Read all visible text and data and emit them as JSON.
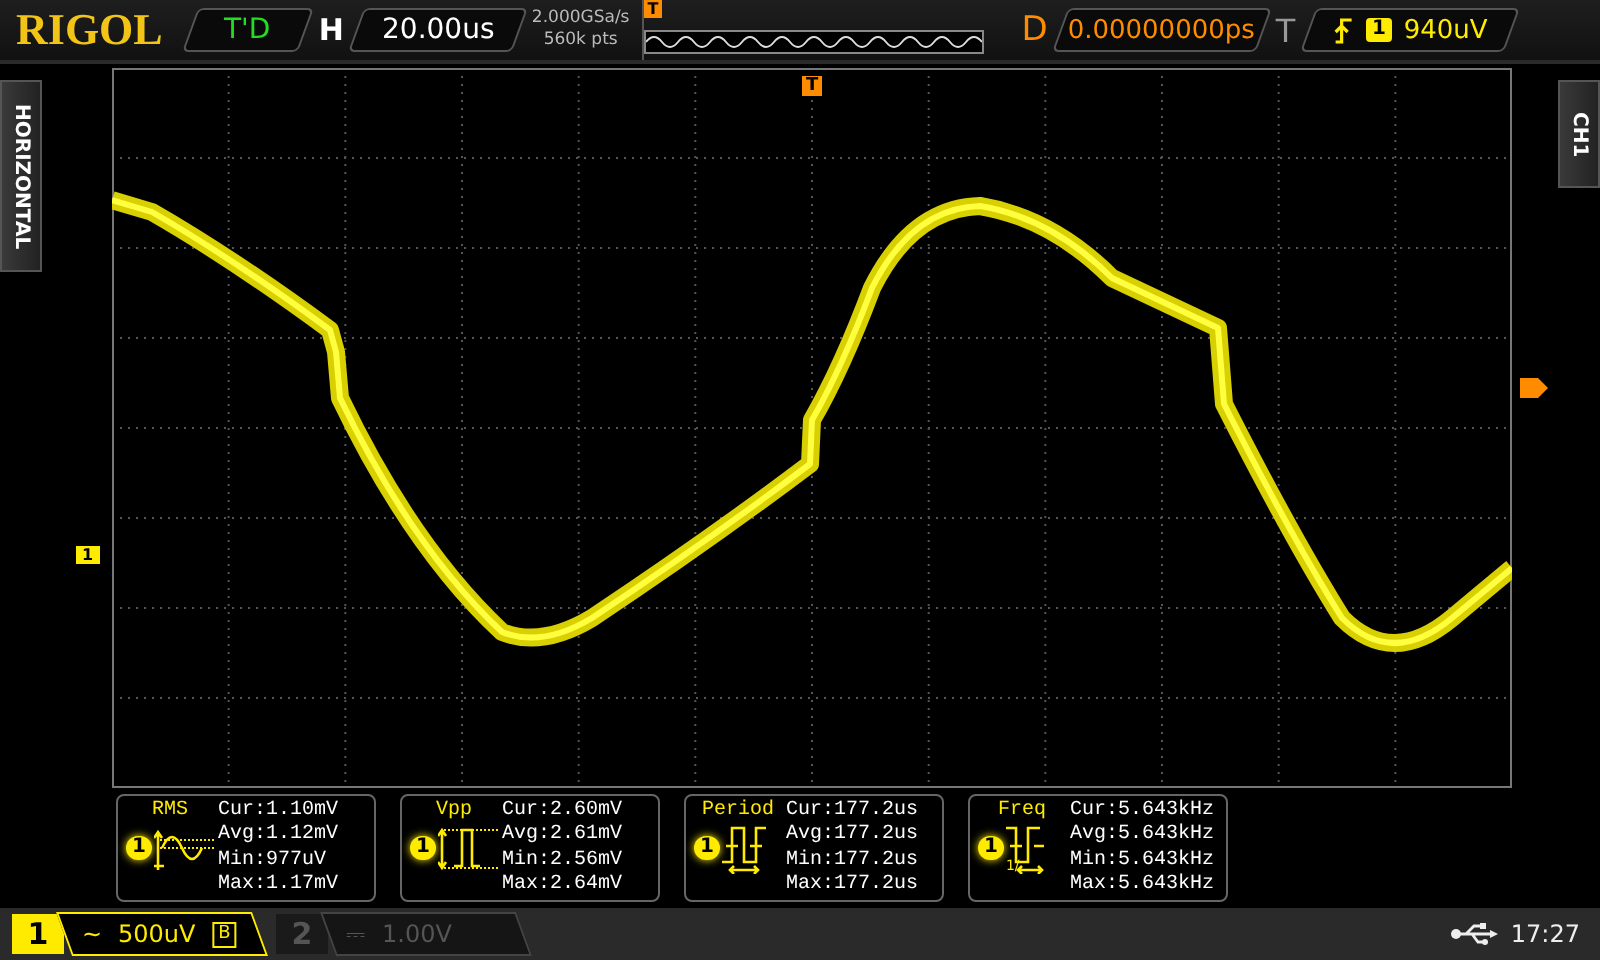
{
  "top_bar": {
    "logo": "RIGOL",
    "run_status": "T'D",
    "timebase_label": "H",
    "timebase": "20.00us",
    "sample_rate": "2.000GSa/s",
    "memory_depth": "560k pts",
    "overview_marker": "T",
    "delay_label": "D",
    "delay": "0.00000000ps",
    "trigger_label": "T",
    "trigger_source": "1",
    "trigger_level": "940uV"
  },
  "side_tabs": {
    "left": "HORIZONTAL",
    "right": "CH1"
  },
  "screen": {
    "trigger_position_marker": "T",
    "channel_marker": "1"
  },
  "measurements": [
    {
      "kind": "rms",
      "label": "RMS",
      "channel": "1",
      "cur": "Cur:1.10mV",
      "avg": "Avg:1.12mV",
      "min": "Min:977uV",
      "max": "Max:1.17mV"
    },
    {
      "kind": "vpp",
      "label": "Vpp",
      "channel": "1",
      "cur": "Cur:2.60mV",
      "avg": "Avg:2.61mV",
      "min": "Min:2.56mV",
      "max": "Max:2.64mV"
    },
    {
      "kind": "period",
      "label": "Period",
      "channel": "1",
      "cur": "Cur:177.2us",
      "avg": "Avg:177.2us",
      "min": "Min:177.2us",
      "max": "Max:177.2us"
    },
    {
      "kind": "freq",
      "label": "Freq",
      "channel": "1",
      "icon_note": "1/",
      "cur": "Cur:5.643kHz",
      "avg": "Avg:5.643kHz",
      "min": "Min:5.643kHz",
      "max": "Max:5.643kHz"
    }
  ],
  "channels": [
    {
      "number": "1",
      "coupling": "~",
      "scale": "500uV",
      "bw_limit": "B",
      "enabled": true
    },
    {
      "number": "2",
      "coupling": "⎓",
      "scale": "1.00V",
      "enabled": false
    }
  ],
  "status": {
    "time": "17:27"
  }
}
